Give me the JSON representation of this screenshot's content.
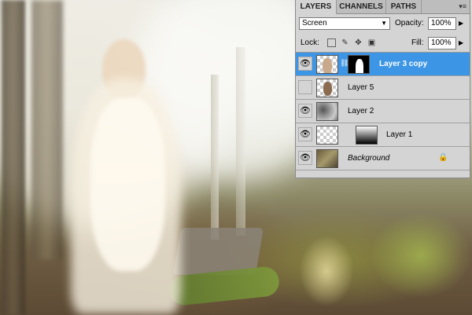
{
  "panel": {
    "tabs": [
      {
        "label": "LAYERS",
        "active": true
      },
      {
        "label": "CHANNELS",
        "active": false
      },
      {
        "label": "PATHS",
        "active": false
      }
    ],
    "menu_icon": "panel-menu-icon",
    "blend_mode": "Screen",
    "opacity_label": "Opacity:",
    "opacity_value": "100%",
    "lock_label": "Lock:",
    "fill_label": "Fill:",
    "fill_value": "100%",
    "lock_icons": [
      "lock-transparency-icon",
      "lock-image-icon",
      "lock-position-icon",
      "lock-all-icon"
    ],
    "layers": [
      {
        "name": "Layer 3 copy",
        "visible": true,
        "selected": true,
        "has_mask": true
      },
      {
        "name": "Layer 5",
        "visible": false,
        "selected": false,
        "has_mask": false
      },
      {
        "name": "Layer 2",
        "visible": true,
        "selected": false,
        "has_mask": false
      },
      {
        "name": "Layer 1",
        "visible": true,
        "selected": false,
        "has_mask": true
      },
      {
        "name": "Background",
        "visible": true,
        "selected": false,
        "has_mask": false,
        "locked": true
      }
    ]
  },
  "colors": {
    "selected_layer": "#3d96e5",
    "panel_bg": "#d4d4d4"
  }
}
